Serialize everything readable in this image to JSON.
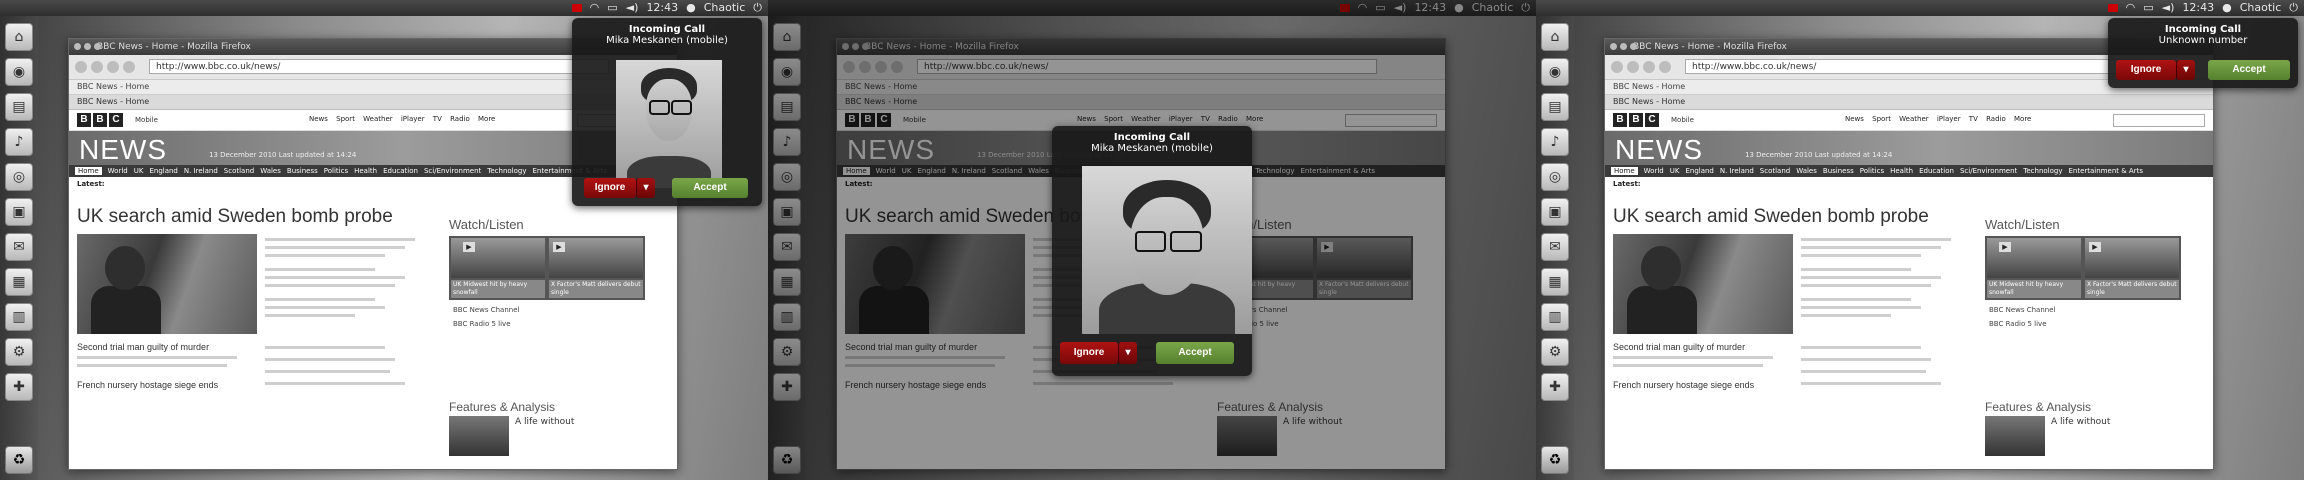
{
  "system": {
    "time": "12:43",
    "user": "Chaotic"
  },
  "browser": {
    "window_title": "BBC News - Home - Mozilla Firefox",
    "url": "http://www.bbc.co.uk/news/",
    "bookmark": "BBC News - Home",
    "tab_title": "BBC News - Home"
  },
  "bbc": {
    "logo_letters": [
      "B",
      "B",
      "C"
    ],
    "mobile_label": "Mobile",
    "top_nav": "News Sport Weather iPlayer TV Radio More",
    "section_title": "NEWS",
    "date_line": "13 December 2010 Last updated at 14:24",
    "sections": [
      "Home",
      "World",
      "UK",
      "England",
      "N. Ireland",
      "Scotland",
      "Wales",
      "Business",
      "Politics",
      "Health",
      "Education",
      "Sci/Environment",
      "Technology",
      "Entertainment & Arts"
    ],
    "latest_label": "Latest:",
    "headline": "UK search amid Sweden bomb probe",
    "story2": "Second trial man guilty of murder",
    "story3": "French nursery hostage siege ends",
    "watch_listen": "Watch/Listen",
    "carousel": [
      {
        "caption": "UK Midwest hit by heavy snowfall"
      },
      {
        "caption": "X Factor's Matt delivers debut single"
      }
    ],
    "channel_links": [
      "BBC News Channel",
      "BBC Radio 5 live"
    ],
    "features": "Features & Analysis",
    "feature1": "A life without"
  },
  "calls": [
    {
      "title": "Incoming Call",
      "caller": "Mika Meskanen (mobile)",
      "ignore": "Ignore",
      "accept": "Accept",
      "dropdown_icon": "triangle-down"
    },
    {
      "title": "Incoming Call",
      "caller": "Mika Meskanen (mobile)",
      "ignore": "Ignore",
      "accept": "Accept",
      "dropdown_icon": "triangle-down"
    },
    {
      "title": "Incoming Call",
      "caller": "Unknown number",
      "ignore": "Ignore",
      "accept": "Accept",
      "dropdown_icon": "triangle-down"
    }
  ],
  "icons": {
    "mail": "envelope-icon",
    "wifi": "wifi-icon",
    "battery": "battery-icon",
    "volume": "speaker-icon",
    "power": "power-icon"
  }
}
